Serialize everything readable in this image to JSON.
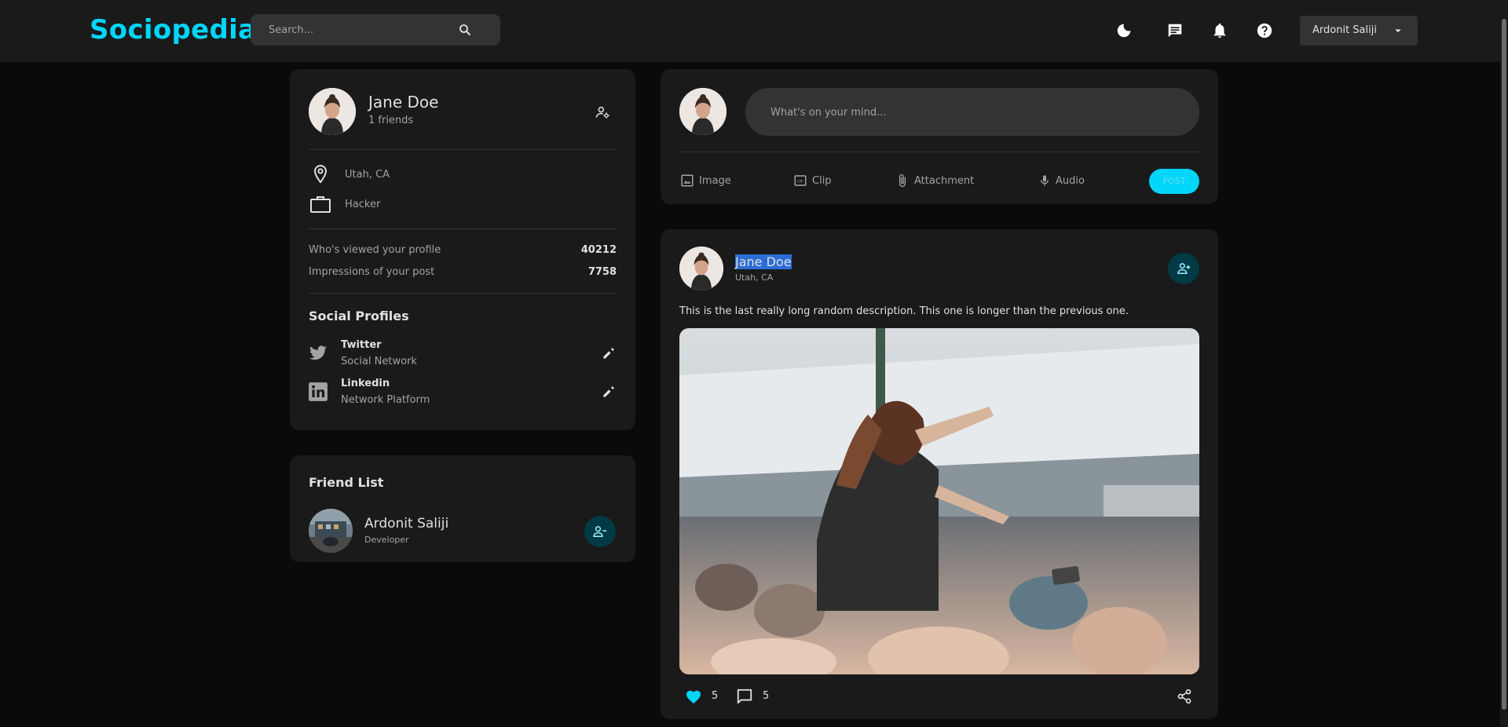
{
  "navbar": {
    "logo": "Sociopedia",
    "search_placeholder": "Search...",
    "user_name": "Ardonit Saliji",
    "accent": "#00d5fa"
  },
  "profile": {
    "name": "Jane Doe",
    "friends": "1 friends",
    "location": "Utah, CA",
    "occupation": "Hacker",
    "stats": [
      {
        "label": "Who's viewed your profile",
        "value": "40212"
      },
      {
        "label": "Impressions of your post",
        "value": "7758"
      }
    ],
    "social_title": "Social Profiles",
    "socials": [
      {
        "name": "Twitter",
        "desc": "Social Network",
        "icon": "twitter-icon"
      },
      {
        "name": "Linkedin",
        "desc": "Network Platform",
        "icon": "linkedin-icon"
      }
    ]
  },
  "friends_widget": {
    "title": "Friend List",
    "friends": [
      {
        "name": "Ardonit Saliji",
        "occupation": "Developer"
      }
    ]
  },
  "composer": {
    "placeholder": "What's on your mind...",
    "tools": [
      "Image",
      "Clip",
      "Attachment",
      "Audio"
    ],
    "post_label": "POST"
  },
  "post": {
    "author": "Jane Doe",
    "location": "Utah, CA",
    "description": "This is the last really long random description. This one is longer than the previous one.",
    "likes": "5",
    "comments": "5"
  }
}
